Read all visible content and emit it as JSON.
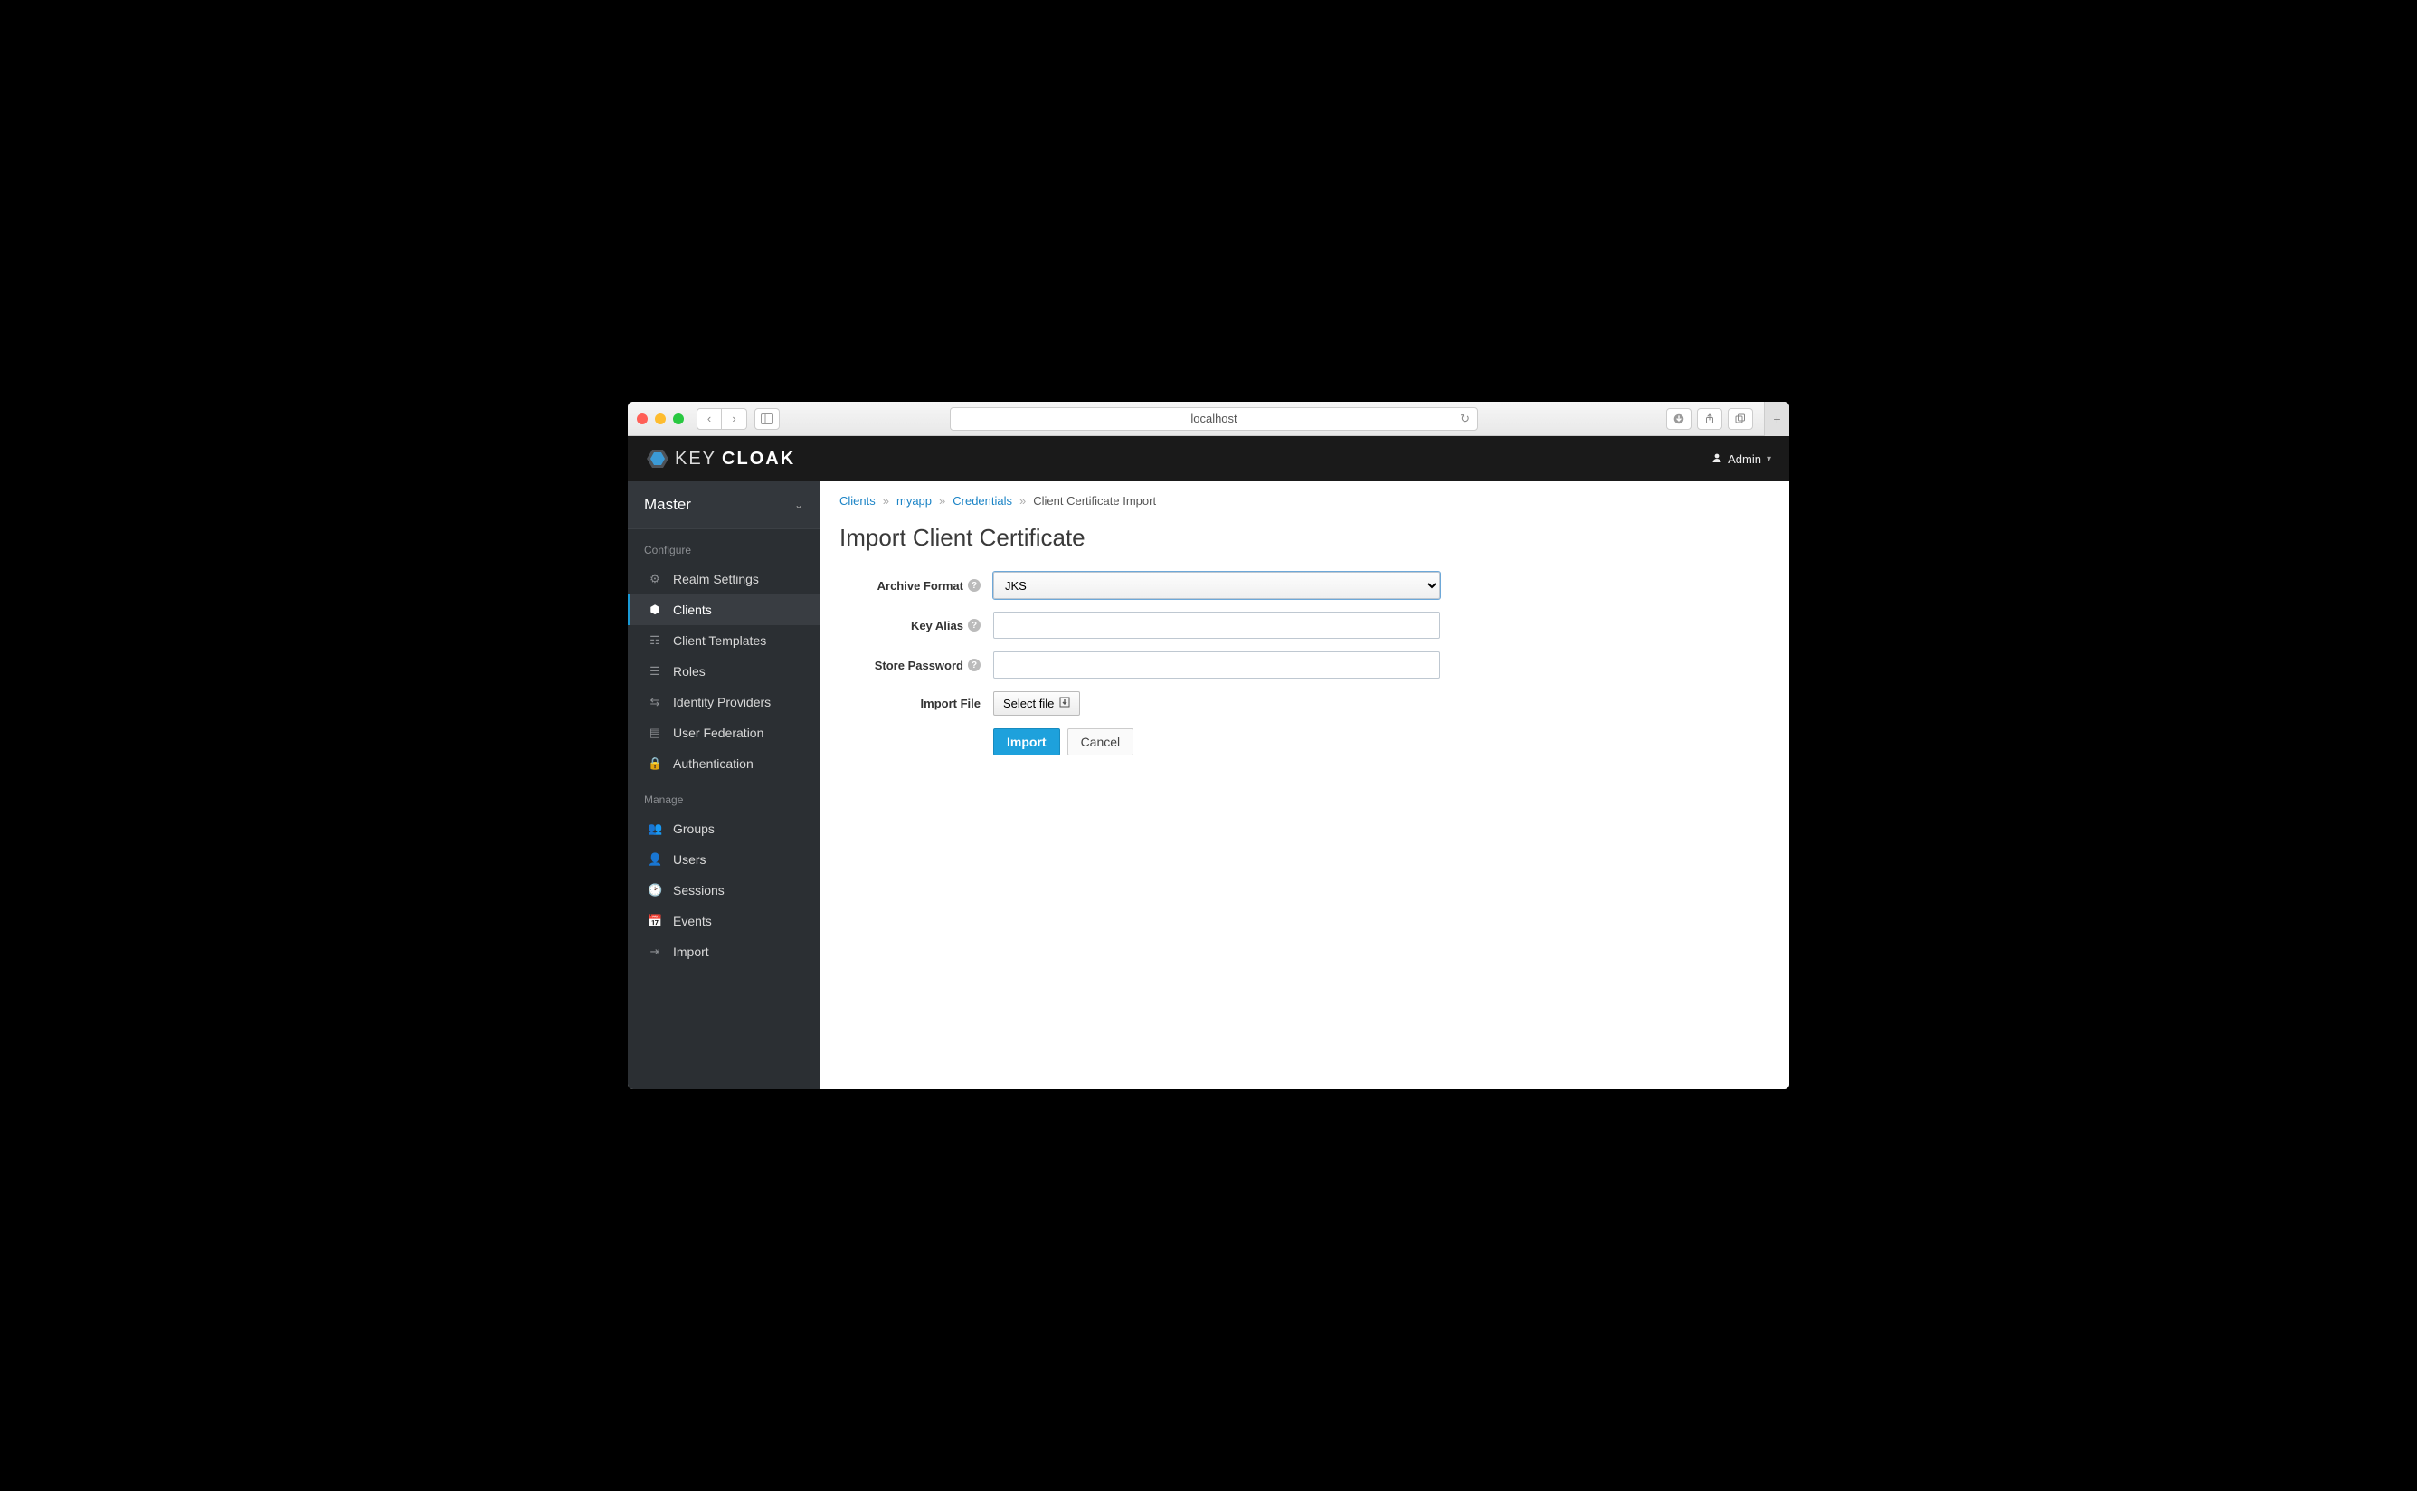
{
  "browser": {
    "url": "localhost"
  },
  "header": {
    "brand_a": "KEY",
    "brand_b": "CLOAK",
    "user": "Admin"
  },
  "realm": {
    "name": "Master"
  },
  "sidebar": {
    "sections": {
      "configure": {
        "title": "Configure",
        "items": [
          {
            "label": "Realm Settings"
          },
          {
            "label": "Clients"
          },
          {
            "label": "Client Templates"
          },
          {
            "label": "Roles"
          },
          {
            "label": "Identity Providers"
          },
          {
            "label": "User Federation"
          },
          {
            "label": "Authentication"
          }
        ]
      },
      "manage": {
        "title": "Manage",
        "items": [
          {
            "label": "Groups"
          },
          {
            "label": "Users"
          },
          {
            "label": "Sessions"
          },
          {
            "label": "Events"
          },
          {
            "label": "Import"
          }
        ]
      }
    }
  },
  "breadcrumbs": {
    "items": [
      "Clients",
      "myapp",
      "Credentials"
    ],
    "current": "Client Certificate Import"
  },
  "page": {
    "title": "Import Client Certificate"
  },
  "form": {
    "archive_format": {
      "label": "Archive Format",
      "value": "JKS"
    },
    "key_alias": {
      "label": "Key Alias",
      "value": ""
    },
    "store_password": {
      "label": "Store Password",
      "value": ""
    },
    "import_file": {
      "label": "Import File",
      "button": "Select file"
    },
    "actions": {
      "import": "Import",
      "cancel": "Cancel"
    }
  }
}
